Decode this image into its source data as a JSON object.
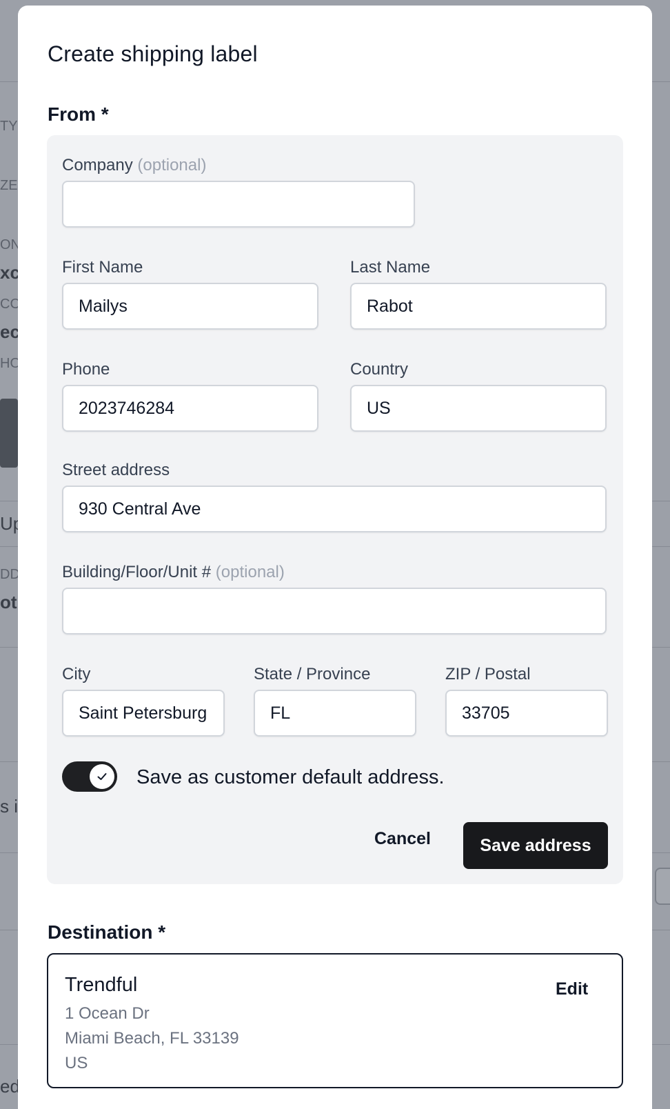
{
  "background": {
    "fragments": [
      "TYL",
      "ZE",
      "ON",
      "xc",
      "CC",
      "ec",
      "HO",
      "Up",
      "DD",
      "ot",
      "s it",
      "ed"
    ]
  },
  "modal": {
    "title": "Create shipping label",
    "from_title": "From *",
    "destination_title": "Destination *"
  },
  "form": {
    "company": {
      "label": "Company",
      "optional": "(optional)",
      "value": ""
    },
    "first_name": {
      "label": "First Name",
      "value": "Mailys"
    },
    "last_name": {
      "label": "Last Name",
      "value": "Rabot"
    },
    "phone": {
      "label": "Phone",
      "value": "2023746284"
    },
    "country": {
      "label": "Country",
      "value": "US"
    },
    "street": {
      "label": "Street address",
      "value": "930 Central Ave"
    },
    "unit": {
      "label": "Building/Floor/Unit #",
      "optional": "(optional)",
      "value": ""
    },
    "city": {
      "label": "City",
      "value": "Saint Petersburg"
    },
    "state": {
      "label": "State / Province",
      "value": "FL"
    },
    "zip": {
      "label": "ZIP / Postal",
      "value": "33705"
    },
    "save_default": {
      "label": "Save as customer default address.",
      "checked": true
    },
    "cancel_label": "Cancel",
    "save_label": "Save address"
  },
  "destination": {
    "name": "Trendful",
    "line1": "1 Ocean Dr",
    "line2": "Miami Beach, FL 33139",
    "line3": "US",
    "edit_label": "Edit"
  },
  "colors": {
    "overlay": "#8e929b",
    "panel": "#f2f3f5",
    "primary_button": "#18191c",
    "toggle_on": "#1f2023"
  }
}
